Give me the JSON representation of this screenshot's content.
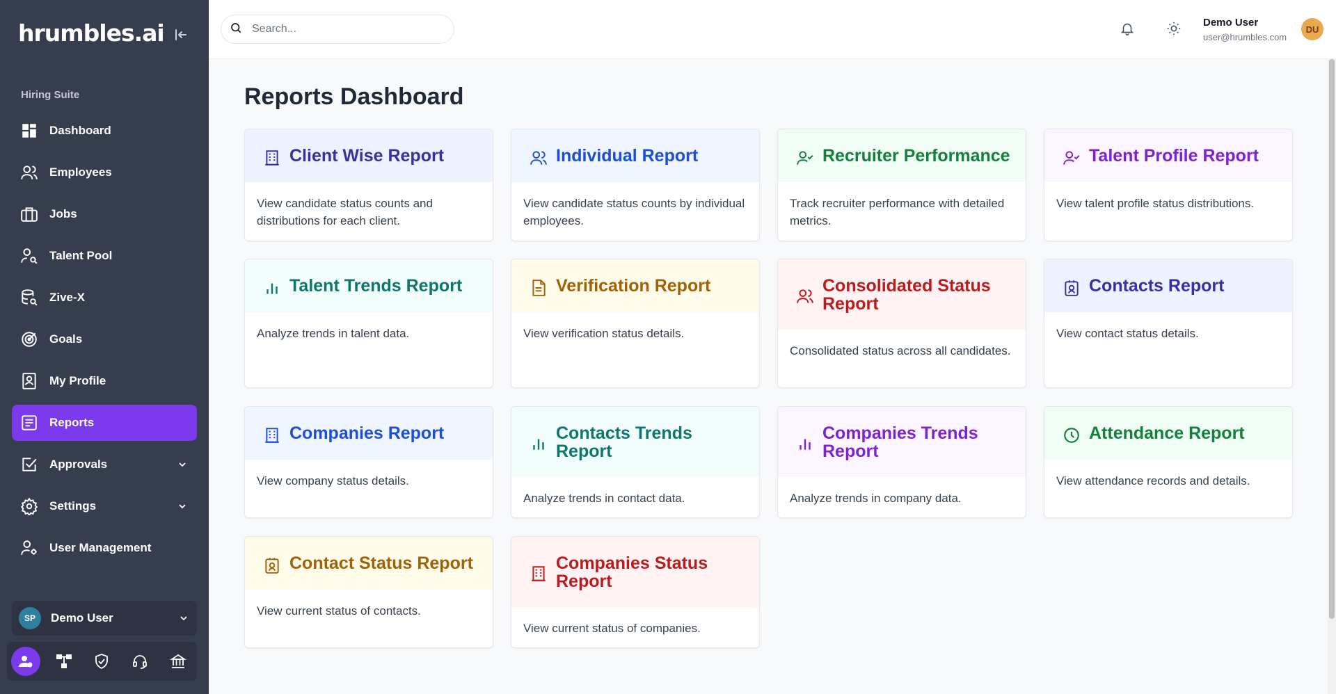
{
  "sidebar": {
    "logo": "hrumbles.ai",
    "section": "Hiring Suite",
    "items": [
      {
        "label": "Dashboard"
      },
      {
        "label": "Employees"
      },
      {
        "label": "Jobs"
      },
      {
        "label": "Talent Pool"
      },
      {
        "label": "Zive-X"
      },
      {
        "label": "Goals"
      },
      {
        "label": "My Profile"
      },
      {
        "label": "Reports"
      },
      {
        "label": "Approvals"
      },
      {
        "label": "Settings"
      },
      {
        "label": "User Management"
      }
    ],
    "user": {
      "initials": "SP",
      "name": "Demo User"
    }
  },
  "header": {
    "search_placeholder": "Search...",
    "user_name": "Demo User",
    "user_email": "user@hrumbles.com",
    "avatar_initials": "DU"
  },
  "main": {
    "title": "Reports Dashboard",
    "cards": [
      {
        "title": "Client Wise Report",
        "desc": "View candidate status counts and distributions for each client."
      },
      {
        "title": "Individual Report",
        "desc": "View candidate status counts by individual employees."
      },
      {
        "title": "Recruiter Performance",
        "desc": "Track recruiter performance with detailed metrics."
      },
      {
        "title": "Talent Profile Report",
        "desc": "View talent profile status distributions."
      },
      {
        "title": "Talent Trends Report",
        "desc": "Analyze trends in talent data."
      },
      {
        "title": "Verification Report",
        "desc": "View verification status details."
      },
      {
        "title": "Consolidated Status Report",
        "desc": "Consolidated status across all candidates."
      },
      {
        "title": "Contacts Report",
        "desc": "View contact status details."
      },
      {
        "title": "Companies Report",
        "desc": "View company status details."
      },
      {
        "title": "Contacts Trends Report",
        "desc": "Analyze trends in contact data."
      },
      {
        "title": "Companies Trends Report",
        "desc": "Analyze trends in company data."
      },
      {
        "title": "Attendance Report",
        "desc": "View attendance records and details."
      },
      {
        "title": "Contact Status Report",
        "desc": "View current status of contacts."
      },
      {
        "title": "Companies Status Report",
        "desc": "View current status of companies."
      }
    ]
  },
  "colors": {
    "sidebar_bg": "#363d4f",
    "active_accent": "#7c3aed",
    "indigo": "#3730a3",
    "blue": "#1d4ed8",
    "green": "#15803d",
    "purple": "#7e22ce",
    "teal": "#0f766e",
    "yellow": "#a16207",
    "red": "#b91c1c"
  },
  "icons": [
    "collapse-icon",
    "dashboard-icon",
    "users-icon",
    "briefcase-icon",
    "user-search-icon",
    "database-search-icon",
    "target-icon",
    "id-card-icon",
    "report-icon",
    "check-square-icon",
    "gear-icon",
    "user-cog-icon",
    "bell-icon",
    "sun-icon",
    "search-icon"
  ]
}
